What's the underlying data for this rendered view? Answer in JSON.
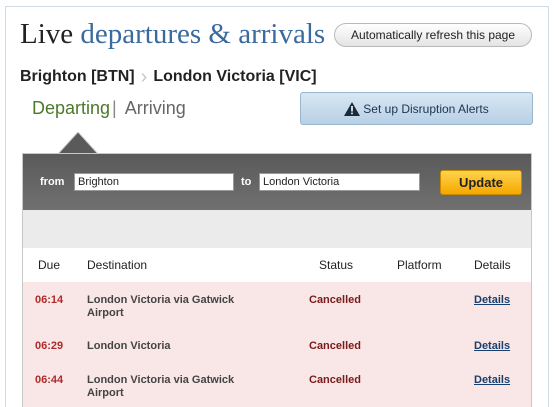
{
  "header": {
    "title_plain": "Live",
    "title_accent": "departures & arrivals",
    "refresh_label": "Automatically refresh this page"
  },
  "route": {
    "from": "Brighton [BTN]",
    "to": "London Victoria [VIC]"
  },
  "tabs": {
    "departing": "Departing",
    "separator": "|",
    "arriving": "Arriving"
  },
  "alerts": {
    "label": "Set up Disruption Alerts",
    "icon": "warning-icon"
  },
  "search": {
    "from_label": "from",
    "from_value": "Brighton",
    "to_label": "to",
    "to_value": "London Victoria",
    "update_label": "Update"
  },
  "table": {
    "headers": [
      "Due",
      "Destination",
      "Status",
      "Platform",
      "Details"
    ],
    "rows": [
      {
        "due": "06:14",
        "destination": "London Victoria via Gatwick Airport",
        "status": "Cancelled",
        "platform": "",
        "details": "Details"
      },
      {
        "due": "06:29",
        "destination": "London Victoria",
        "status": "Cancelled",
        "platform": "",
        "details": "Details"
      },
      {
        "due": "06:44",
        "destination": "London Victoria via Gatwick Airport",
        "status": "Cancelled",
        "platform": "",
        "details": "Details"
      }
    ]
  },
  "colors": {
    "accent": "#3a6a9e",
    "departing_green": "#4b7a2a",
    "cancelled_row": "#f9e7e7",
    "update_button": "#f6a800"
  }
}
